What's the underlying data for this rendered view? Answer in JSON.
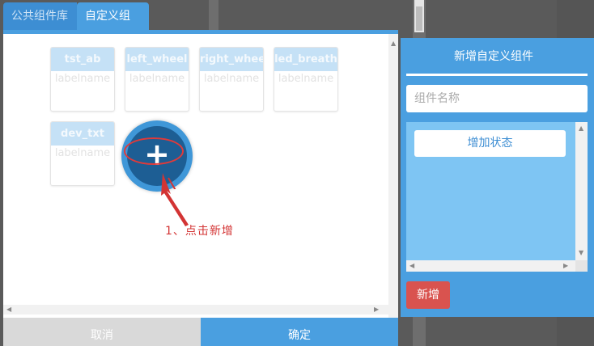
{
  "tabs": [
    {
      "label": "公共组件库"
    },
    {
      "label": "自定义组件"
    }
  ],
  "components": [
    {
      "name": "tst_ab",
      "label": "labelname"
    },
    {
      "name": "left_wheel",
      "label": "labelname"
    },
    {
      "name": "right_wheel",
      "label": "labelname"
    },
    {
      "name": "led_breath",
      "label": "labelname"
    },
    {
      "name": "dev_txt",
      "label": "labelname"
    }
  ],
  "add_button": {
    "symbol": "+"
  },
  "annotation": {
    "text": "1、点击新增",
    "color": "#d33434"
  },
  "footer": {
    "cancel_label": "取消",
    "ok_label": "确定"
  },
  "panel": {
    "title": "新增自定义组件",
    "name_placeholder": "组件名称",
    "add_state_label": "增加状态",
    "new_label": "新增"
  },
  "colors": {
    "accent": "#4a9fe0",
    "danger": "#d9534f",
    "state_bg": "#7ec5f3"
  }
}
